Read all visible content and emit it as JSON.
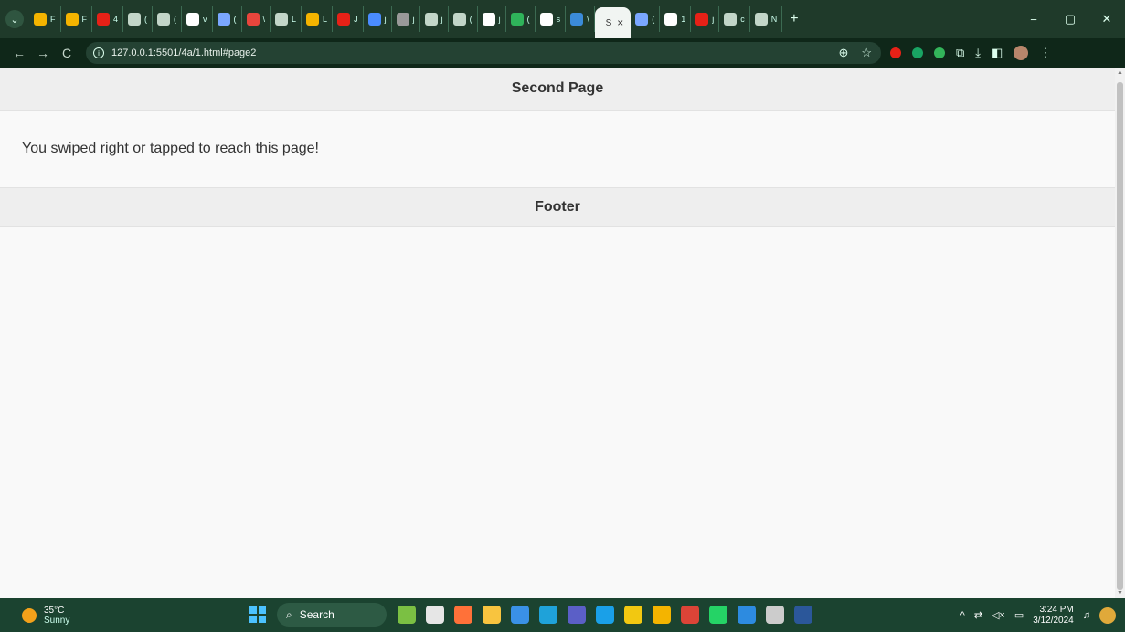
{
  "browser": {
    "tab_strip": {
      "menu_icon": "chevron-down-icon",
      "tabs": [
        {
          "label": "F",
          "color": "#f4b400"
        },
        {
          "label": "F",
          "color": "#f4b400"
        },
        {
          "label": "4",
          "color": "#e62117"
        },
        {
          "label": "(",
          "color": "#c2d5c8"
        },
        {
          "label": "(",
          "color": "#c2d5c8"
        },
        {
          "label": "v",
          "color": "#ffffff"
        },
        {
          "label": "(",
          "color": "#7aa7ff"
        },
        {
          "label": "\\",
          "color": "#e8453c"
        },
        {
          "label": "L",
          "color": "#c2d5c8"
        },
        {
          "label": "L",
          "color": "#f4b400"
        },
        {
          "label": "J",
          "color": "#e62117"
        },
        {
          "label": "j",
          "color": "#4a8cff"
        },
        {
          "label": "j",
          "color": "#999999"
        },
        {
          "label": "j",
          "color": "#c2d5c8"
        },
        {
          "label": "(",
          "color": "#c2d5c8"
        },
        {
          "label": "j",
          "color": "#ffffff"
        },
        {
          "label": "(",
          "color": "#2fb35a"
        },
        {
          "label": "s",
          "color": "#ffffff"
        },
        {
          "label": "\\",
          "color": "#3b8bd9"
        }
      ],
      "active_tab": {
        "label": "S",
        "close": "×"
      },
      "after_tabs": [
        {
          "label": "(",
          "color": "#7aa7ff"
        },
        {
          "label": "1",
          "color": "#ffffff"
        },
        {
          "label": "j",
          "color": "#e62117"
        },
        {
          "label": "c",
          "color": "#c2d5c8"
        },
        {
          "label": "N",
          "color": "#c2d5c8"
        }
      ],
      "new_tab": "+",
      "window_controls": [
        "−",
        "▢",
        "✕"
      ]
    },
    "toolbar": {
      "back": "←",
      "forward": "→",
      "reload": "C",
      "url": "127.0.0.1:5501/4a/1.html#page2",
      "zoom_icon": "⊕",
      "bookmark_icon": "☆",
      "extensions": [
        {
          "name": "youtube-ext-icon",
          "color": "#e62117"
        },
        {
          "name": "green-ext-icon",
          "color": "#19a463"
        },
        {
          "name": "shield-ext-icon",
          "color": "#33b55a"
        }
      ],
      "puzzle": "⧉",
      "download": "⤓",
      "sidepanel": "◧",
      "menu": "⋮"
    }
  },
  "page": {
    "header_title": "Second Page",
    "content_text": "You swiped right or tapped to reach this page!",
    "footer_title": "Footer"
  },
  "taskbar": {
    "weather": {
      "temp": "35°C",
      "condition": "Sunny"
    },
    "search_label": "Search",
    "apps": [
      {
        "name": "widgets-icon",
        "color": "#7bc043"
      },
      {
        "name": "task-view-icon",
        "color": "#e6e6e6"
      },
      {
        "name": "firefox-icon",
        "color": "#ff7139"
      },
      {
        "name": "file-explorer-icon",
        "color": "#f8c43f"
      },
      {
        "name": "store-icon",
        "color": "#3a91e6"
      },
      {
        "name": "edge-icon",
        "color": "#1fa2d9"
      },
      {
        "name": "teams-icon",
        "color": "#5b5fc7"
      },
      {
        "name": "prime-video-icon",
        "color": "#1aa0e8"
      },
      {
        "name": "power-bi-icon",
        "color": "#f2c811"
      },
      {
        "name": "chrome-icon",
        "color": "#f4b400"
      },
      {
        "name": "chrome-profile-icon",
        "color": "#db4437"
      },
      {
        "name": "whatsapp-icon",
        "color": "#25d366"
      },
      {
        "name": "vscode-icon",
        "color": "#2d8be0"
      },
      {
        "name": "terminal-icon",
        "color": "#cccccc"
      },
      {
        "name": "word-icon",
        "color": "#2b579a"
      }
    ],
    "tray": {
      "chevron": "^",
      "network_icon": "⇄",
      "sound_icon": "◁×",
      "battery_icon": "▭",
      "time": "3:24 PM",
      "date": "3/12/2024",
      "bell_icon": "🔔"
    }
  }
}
